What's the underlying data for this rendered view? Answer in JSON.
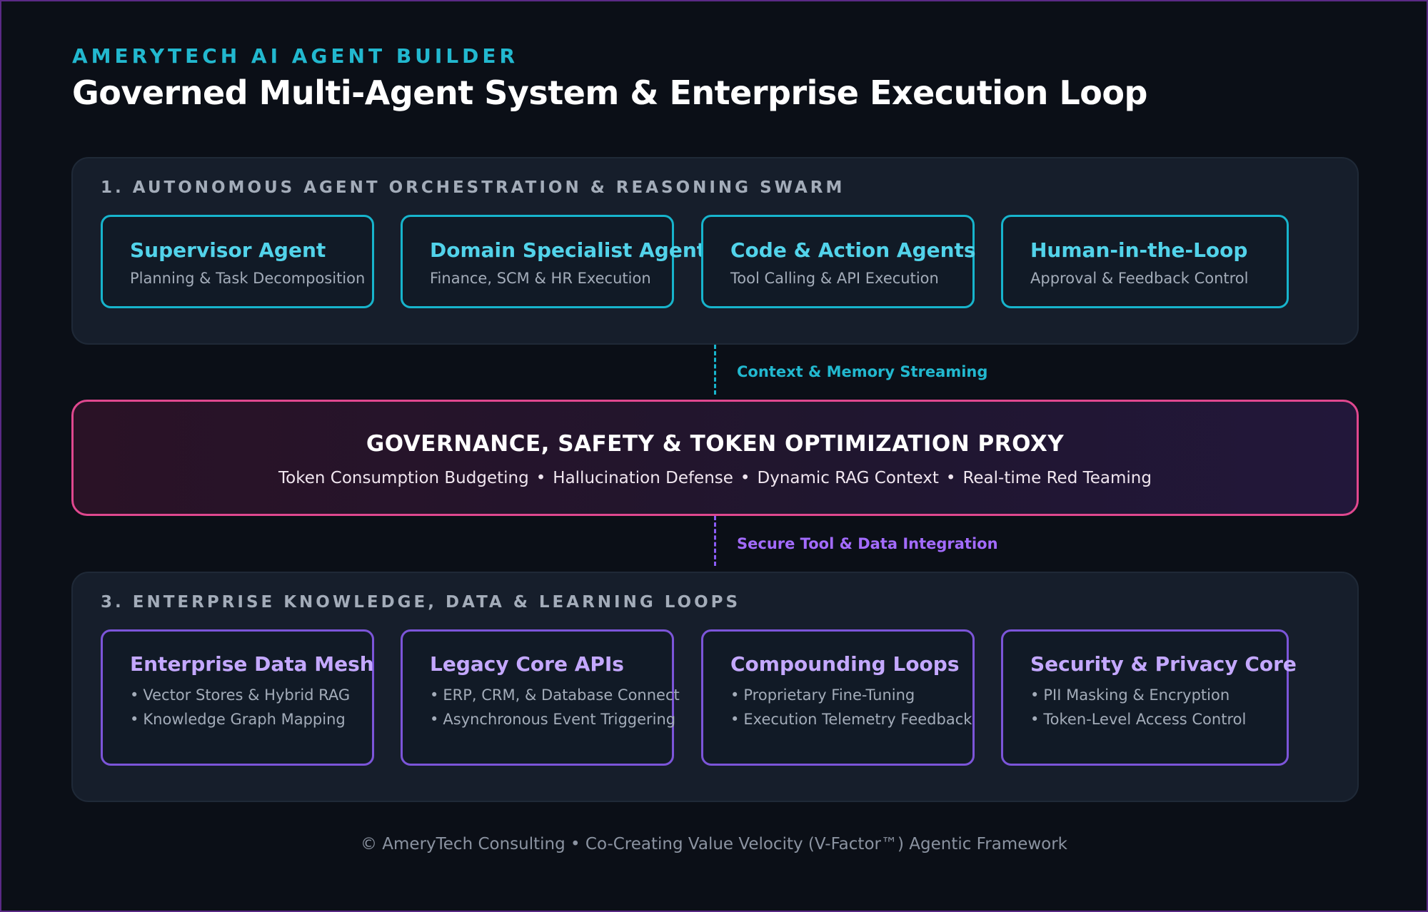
{
  "header": {
    "eyebrow": "AMERYTECH AI AGENT BUILDER",
    "title": "Governed Multi-Agent System & Enterprise Execution Loop"
  },
  "section1": {
    "label": "1. AUTONOMOUS AGENT ORCHESTRATION & REASONING SWARM",
    "cards": [
      {
        "title": "Supervisor Agent",
        "subtitle": "Planning & Task Decomposition"
      },
      {
        "title": "Domain Specialist Agents",
        "subtitle": "Finance, SCM & HR Execution"
      },
      {
        "title": "Code & Action Agents",
        "subtitle": "Tool Calling & API Execution"
      },
      {
        "title": "Human-in-the-Loop",
        "subtitle": "Approval & Feedback Control"
      }
    ]
  },
  "connector_top": {
    "label": "Context & Memory Streaming"
  },
  "proxy": {
    "title": "GOVERNANCE, SAFETY & TOKEN OPTIMIZATION PROXY",
    "items": [
      "Token Consumption Budgeting",
      "Hallucination Defense",
      "Dynamic RAG Context",
      "Real-time Red Teaming"
    ],
    "separator": "•"
  },
  "connector_bottom": {
    "label": "Secure Tool & Data Integration"
  },
  "section3": {
    "label": "3. ENTERPRISE KNOWLEDGE, DATA & LEARNING LOOPS",
    "bullet": "•",
    "cards": [
      {
        "title": "Enterprise Data Mesh",
        "bullets": [
          "Vector Stores & Hybrid RAG",
          "Knowledge Graph Mapping"
        ]
      },
      {
        "title": "Legacy Core APIs",
        "bullets": [
          "ERP, CRM, & Database Connect",
          "Asynchronous Event Triggering"
        ]
      },
      {
        "title": "Compounding Loops",
        "bullets": [
          "Proprietary Fine-Tuning",
          "Execution Telemetry Feedback"
        ]
      },
      {
        "title": "Security & Privacy Core",
        "bullets": [
          "PII Masking & Encryption",
          "Token-Level Access Control"
        ]
      }
    ]
  },
  "footer": {
    "text": "© AmeryTech Consulting • Co-Creating Value Velocity (V-Factor™) Agentic Framework"
  },
  "colors": {
    "background": "#0b0f17",
    "accent_cyan": "#17b4cc",
    "accent_purple": "#7c55d9",
    "accent_pink": "#e0488f"
  }
}
